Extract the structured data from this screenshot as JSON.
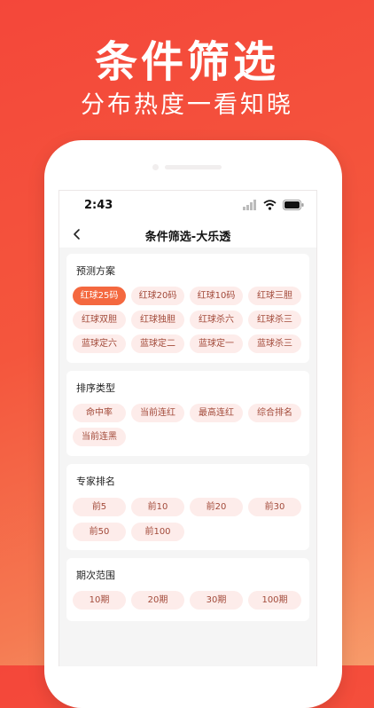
{
  "hero": {
    "title": "条件筛选",
    "subtitle": "分布热度一看知晓"
  },
  "status_bar": {
    "time": "2:43",
    "icons": [
      "signal-icon",
      "wifi-icon",
      "battery-icon"
    ]
  },
  "nav": {
    "back_icon": "chevron-left-icon",
    "title": "条件筛选-大乐透"
  },
  "sections": {
    "scheme": {
      "title": "预测方案",
      "options": [
        "红球25码",
        "红球20码",
        "红球10码",
        "红球三胆",
        "红球双胆",
        "红球独胆",
        "红球杀六",
        "红球杀三",
        "蓝球定六",
        "蓝球定二",
        "蓝球定一",
        "蓝球杀三"
      ],
      "selected": "红球25码"
    },
    "sort": {
      "title": "排序类型",
      "options": [
        "命中率",
        "当前连红",
        "最高连红",
        "综合排名",
        "当前连黑"
      ]
    },
    "rank": {
      "title": "专家排名",
      "options": [
        "前5",
        "前10",
        "前20",
        "前30",
        "前50",
        "前100"
      ]
    },
    "period": {
      "title": "期次范围",
      "options": [
        "10期",
        "20期",
        "30期",
        "100期"
      ]
    }
  },
  "colors": {
    "accent": "#f4683f",
    "chip_bg": "#fdecea",
    "chip_text": "#a24a3a",
    "background_start": "#f4473a",
    "background_end": "#f79b6a"
  }
}
